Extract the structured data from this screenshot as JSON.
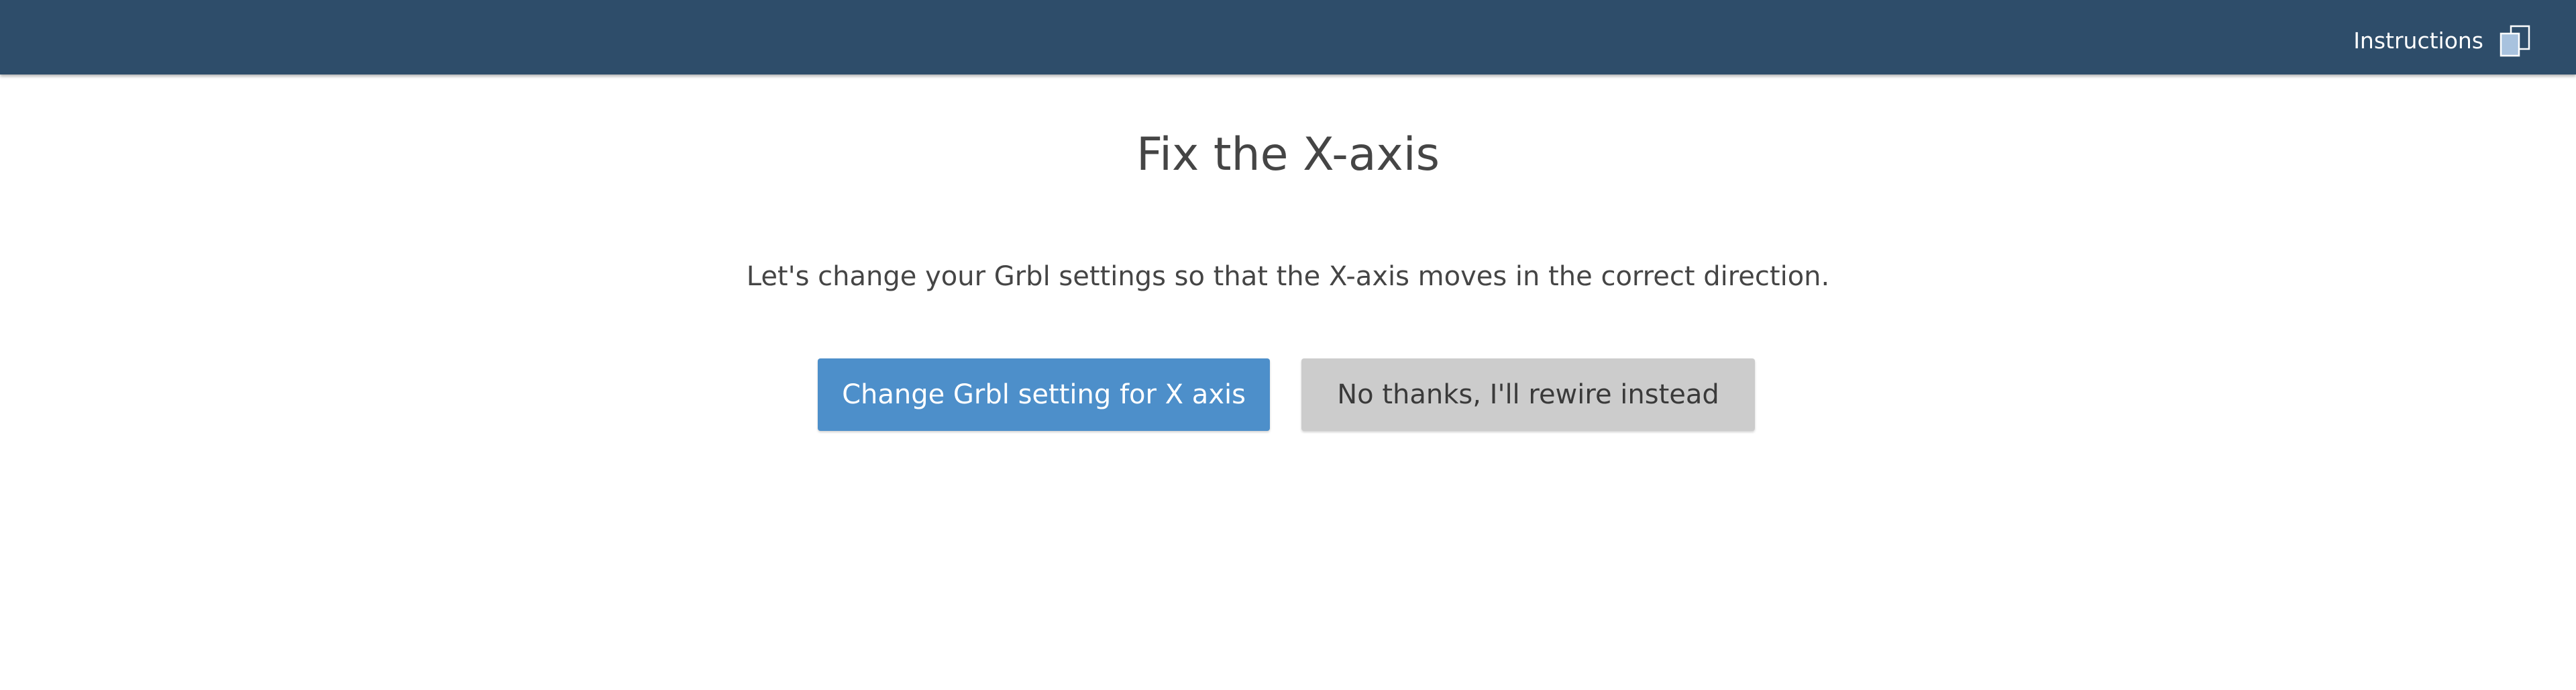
{
  "header": {
    "instructions_label": "Instructions",
    "instructions_icon": "copy-icon",
    "background_color": "#2e4d6a"
  },
  "main": {
    "title": "Fix the X-axis",
    "description": "Let's change your Grbl settings so that the X-axis moves in the correct direction.",
    "primary_button_label": "Change Grbl setting for X axis",
    "secondary_button_label": "No thanks, I'll rewire instead"
  },
  "colors": {
    "primary_button": "#4d8fca",
    "secondary_button": "#cccccc",
    "text": "#454545"
  }
}
